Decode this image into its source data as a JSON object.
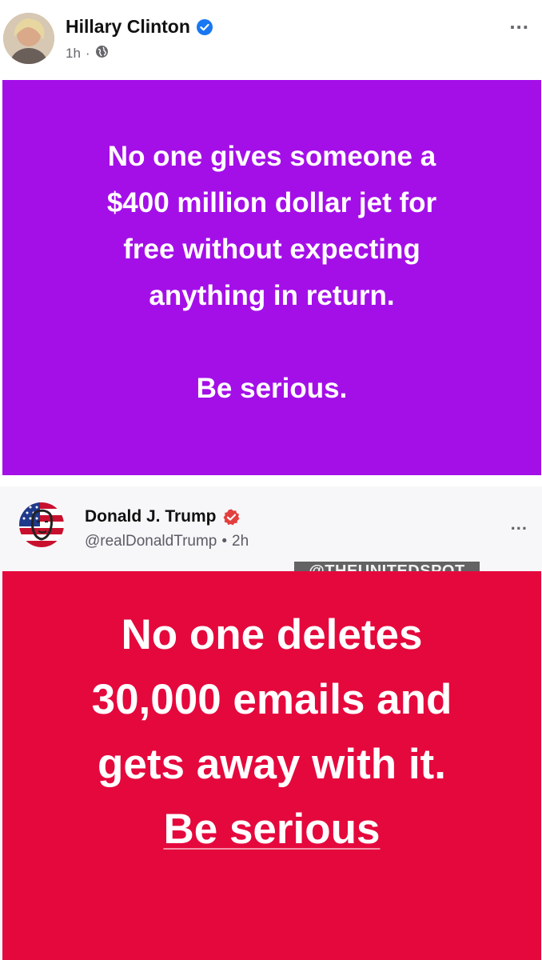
{
  "posts": [
    {
      "author": "Hillary Clinton",
      "time": "1h",
      "separator": "·",
      "visibility_icon": "globe-icon",
      "more_icon": "more-options-icon",
      "more_label": "...",
      "card_color": "#a40fe8",
      "message_lines": [
        "No one gives someone a",
        "$400 million dollar jet for",
        "free without expecting",
        "anything in return."
      ],
      "closing": "Be serious."
    },
    {
      "author": "Donald J. Trump",
      "handle": "@realDonaldTrump",
      "separator": "•",
      "time": "2h",
      "more_icon": "more-options-icon",
      "more_label": "...",
      "card_color": "#e5083d",
      "message_lines": [
        "No one deletes",
        "30,000 emails and",
        "gets away with it."
      ],
      "closing": "Be serious",
      "watermark": "@THEUNITEDSPOT"
    }
  ],
  "colors": {
    "facebook_verified": "#1877f2",
    "truth_verified": "#e33f3f"
  }
}
